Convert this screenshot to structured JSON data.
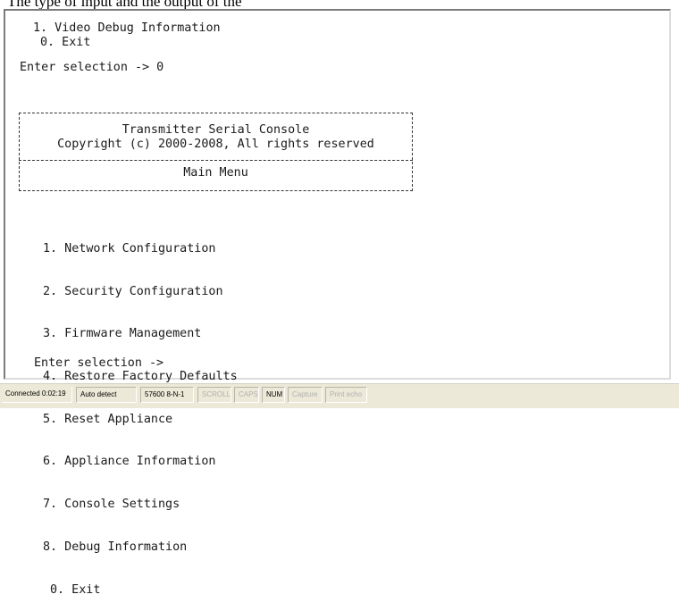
{
  "top_caption": "The type of input and the output of the",
  "terminal": {
    "lines": [
      "1. Video Debug Information",
      "0. Exit",
      "",
      "Enter selection -> 0"
    ],
    "banner": {
      "title": "Transmitter Serial Console",
      "copyright": "Copyright (c) 2000-2008, All rights reserved",
      "section": "Main Menu"
    },
    "menu": [
      "1. Network Configuration",
      "2. Security Configuration",
      "3. Firmware Management",
      "4. Restore Factory Defaults",
      "5. Reset Appliance",
      "6. Appliance Information",
      "7. Console Settings",
      "8. Debug Information",
      "0. Exit"
    ],
    "prompt": "Enter selection ->"
  },
  "status_bar": {
    "connected": "Connected 0:02:19",
    "detect": "Auto detect",
    "port": "57600 8-N-1",
    "scroll": "SCROLL",
    "caps": "CAPS",
    "num": "NUM",
    "capture": "Capture",
    "print_echo": "Print echo"
  }
}
